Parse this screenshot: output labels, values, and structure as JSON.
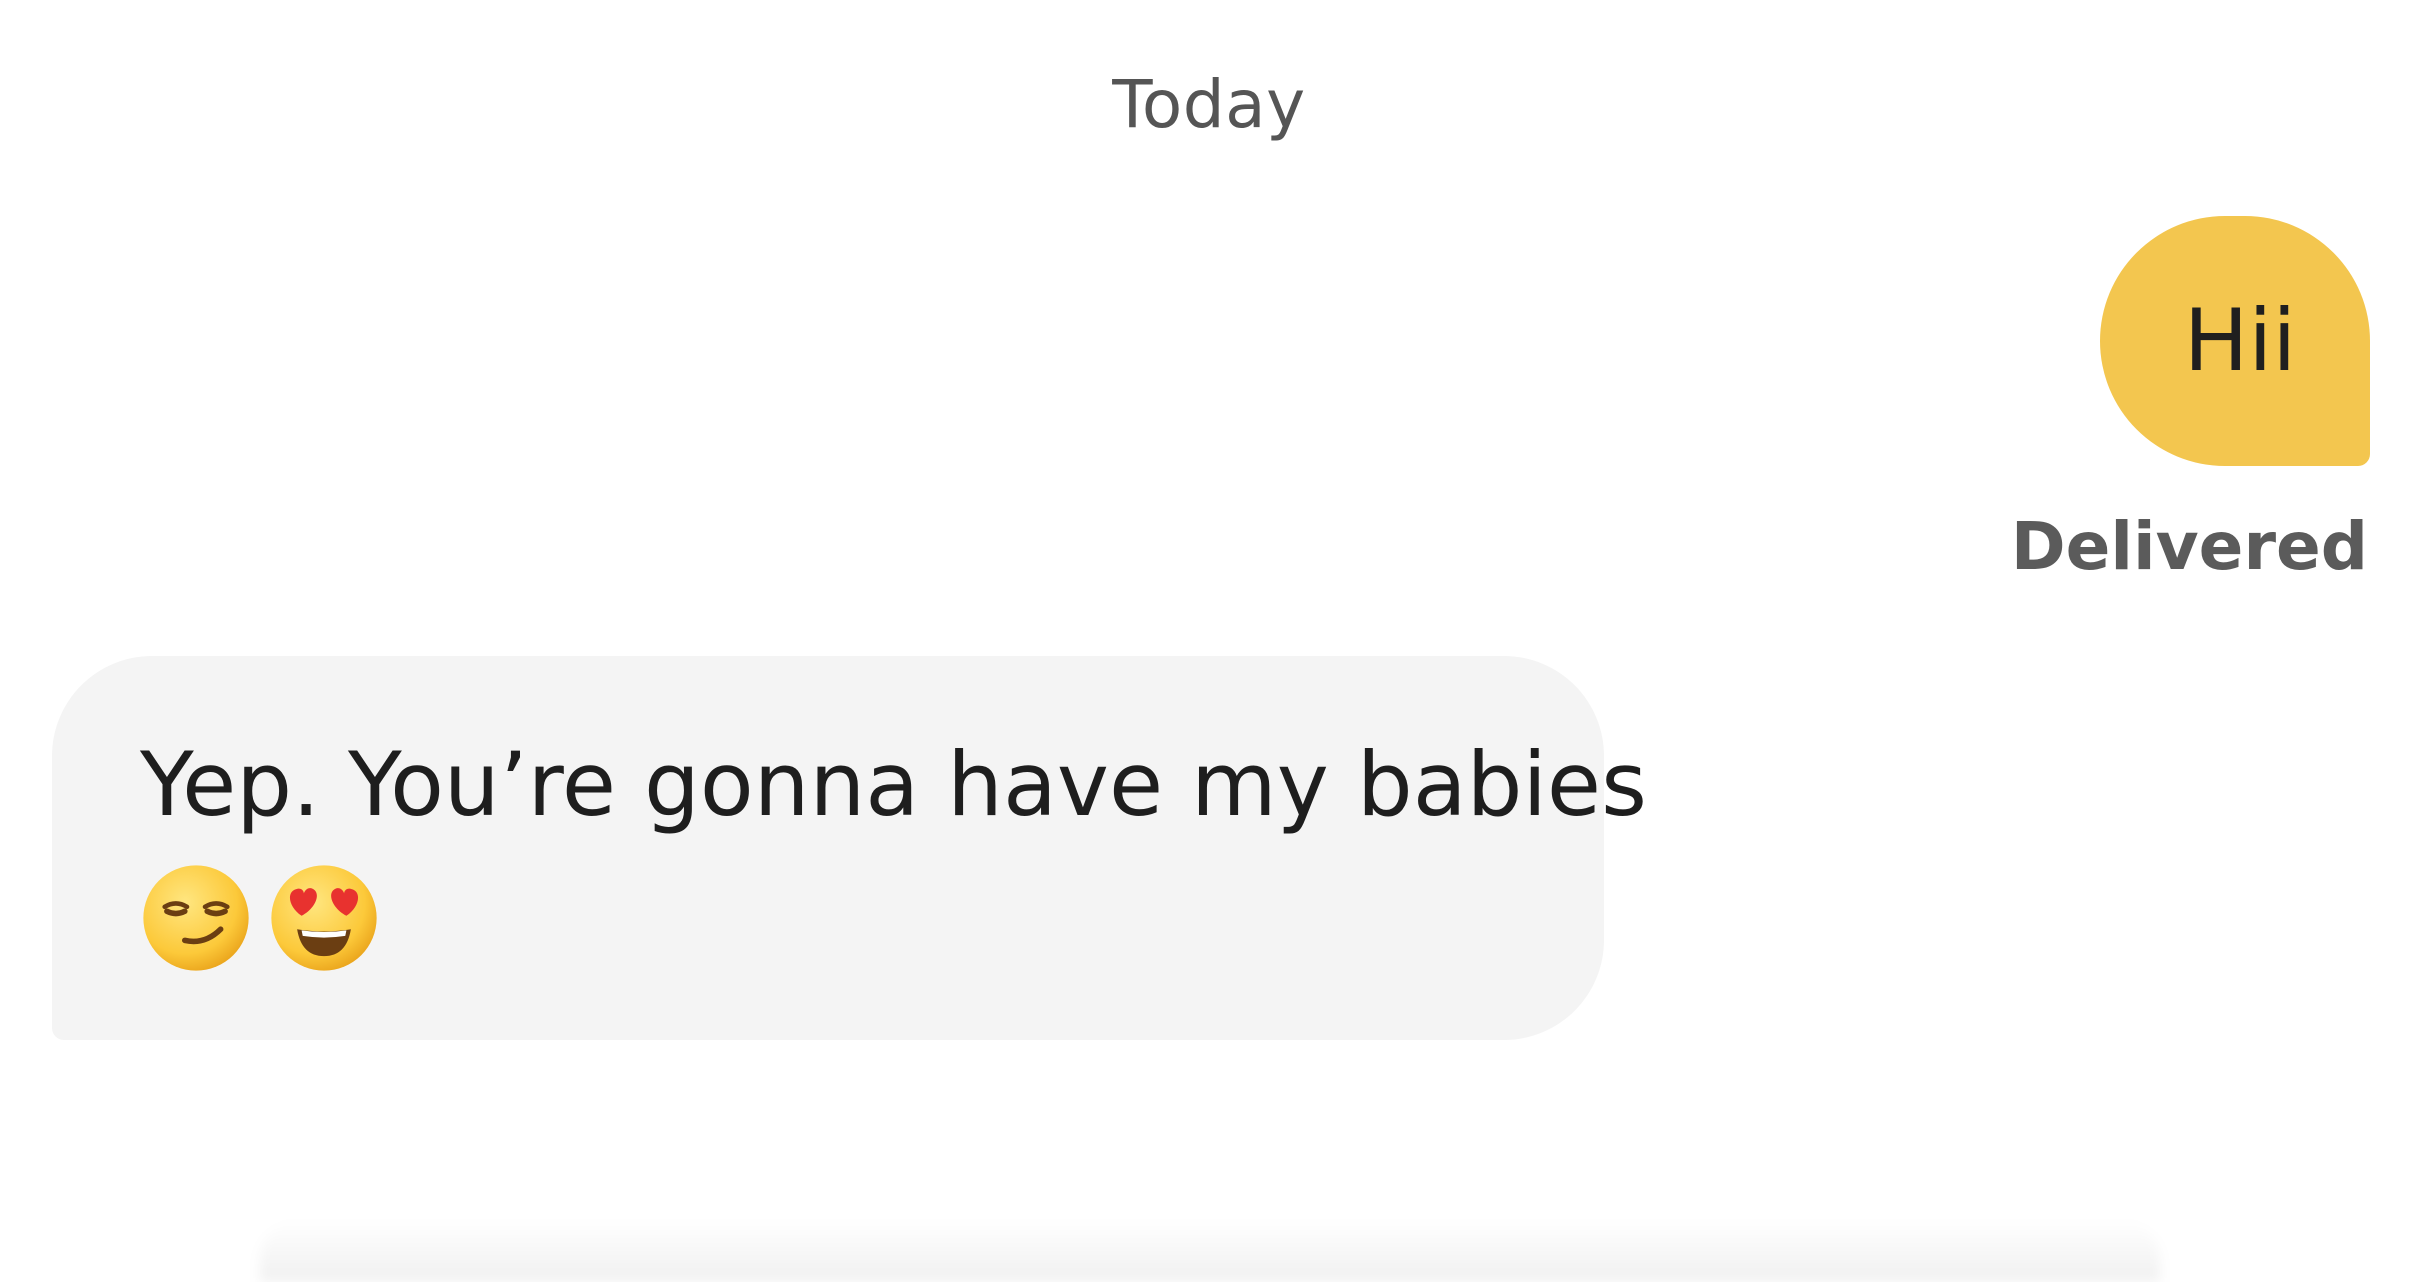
{
  "conversation": {
    "day_separator": "Today",
    "messages": [
      {
        "direction": "outgoing",
        "text": "Hii",
        "status": "Delivered",
        "bubble_color": "#f3c64f"
      },
      {
        "direction": "incoming",
        "text": "Yep. You’re gonna have my babies",
        "emojis": [
          "smirking-face-emoji",
          "heart-eyes-emoji"
        ],
        "bubble_color": "#f4f4f4"
      }
    ]
  }
}
